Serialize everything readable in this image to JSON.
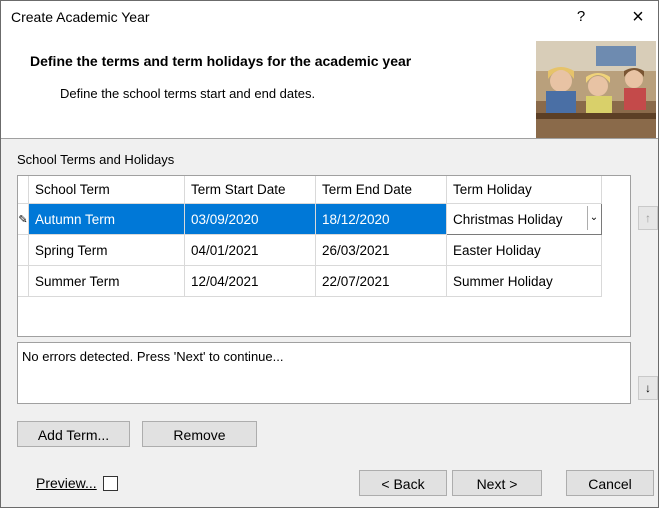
{
  "window": {
    "title": "Create Academic Year",
    "help_label": "?",
    "close_label": "×"
  },
  "header": {
    "title": "Define the terms and term holidays for the academic year",
    "subtitle": "Define the school terms start and end dates."
  },
  "section_label": "School Terms and Holidays",
  "grid": {
    "columns": [
      "School Term",
      "Term Start Date",
      "Term End Date",
      "Term Holiday"
    ],
    "rows": [
      {
        "term": "Autumn Term",
        "start": "03/09/2020",
        "end": "18/12/2020",
        "holiday": "Christmas Holiday",
        "selected": true
      },
      {
        "term": "Spring Term",
        "start": "04/01/2021",
        "end": "26/03/2021",
        "holiday": "Easter Holiday",
        "selected": false
      },
      {
        "term": "Summer Term",
        "start": "12/04/2021",
        "end": "22/07/2021",
        "holiday": "Summer Holiday",
        "selected": false
      }
    ],
    "row_indicator": "✎"
  },
  "side_buttons": {
    "up": "↑",
    "down": "↓"
  },
  "message": "No errors detected. Press 'Next' to continue...",
  "buttons": {
    "add_term": "Add Term...",
    "remove": "Remove",
    "back": "< Back",
    "next": "Next >",
    "cancel": "Cancel"
  },
  "preview": {
    "label": "Preview...",
    "checked": false
  },
  "colors": {
    "selection": "#0078d7",
    "panel": "#f0f0f0",
    "header_bg": "#ffffff"
  }
}
